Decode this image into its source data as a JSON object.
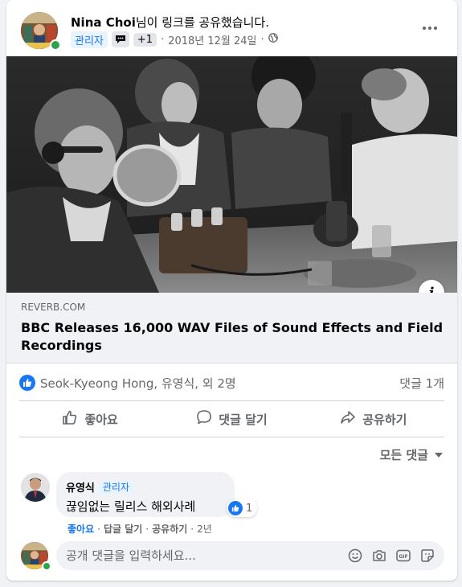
{
  "post": {
    "author": "Nina Choi",
    "action": "님이 링크를 공유했습니다.",
    "admin_badge": "관리자",
    "plus_badge": "+1",
    "date": "2018년 12월 24일",
    "privacy_icon": "globe-icon",
    "more_icon": "more-horizontal-icon"
  },
  "link": {
    "domain": "REVERB.COM",
    "title": "BBC Releases 16,000 WAV Files of Sound Effects and Field Recordings",
    "info_label": "i"
  },
  "reactions": {
    "icon": "like-icon",
    "names": "Seok-Kyeong Hong, 유영식, 외 2명",
    "comment_count": "댓글 1개"
  },
  "actions": {
    "like": "좋아요",
    "comment": "댓글 달기",
    "share": "공유하기"
  },
  "sort": {
    "label": "모든 댓글"
  },
  "comment": {
    "author": "유영식",
    "admin_badge": "관리자",
    "text": "끊임없는 릴리스 해외사례",
    "reaction_count": "1",
    "like_link": "좋아요",
    "reply_link": "답글 달기",
    "share_link": "공유하기",
    "time": "2년",
    "separator": "·"
  },
  "composer": {
    "placeholder": "공개 댓글을 입력하세요...",
    "icons": [
      "emoji-icon",
      "camera-icon",
      "gif-icon",
      "sticker-icon"
    ]
  },
  "colors": {
    "accent": "#1877f2",
    "online": "#31a24c",
    "secondary_text": "#65676b",
    "surface": "#f0f2f5"
  }
}
